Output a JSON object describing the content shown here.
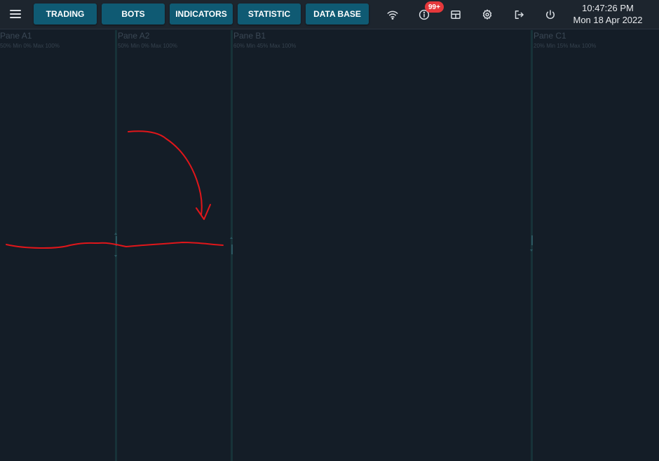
{
  "toolbar": {
    "menu_icon": "hamburger-menu-icon",
    "nav": [
      "TRADING",
      "BOTS",
      "INDICATORS",
      "STATISTIC",
      "DATA BASE"
    ],
    "icons": [
      "wifi-icon",
      "info-icon",
      "layout-icon",
      "gear-icon",
      "logout-icon",
      "power-icon"
    ],
    "notification_badge": "99+",
    "accent_color": "#0f5a73",
    "badge_color": "#e5383b"
  },
  "clock": {
    "time": "10:47:26 PM",
    "date": "Mon 18 Apr 2022"
  },
  "panes": [
    {
      "title": "Pane A1",
      "info": "50% Min 0% Max 100%"
    },
    {
      "title": "Pane A2",
      "info": "50% Min 0% Max 100%"
    },
    {
      "title": "Pane B1",
      "info": "60% Min 45% Max 100%"
    },
    {
      "title": "Pane C1",
      "info": "20% Min 15% Max 100%"
    }
  ],
  "annotation_color": "#e0161a"
}
